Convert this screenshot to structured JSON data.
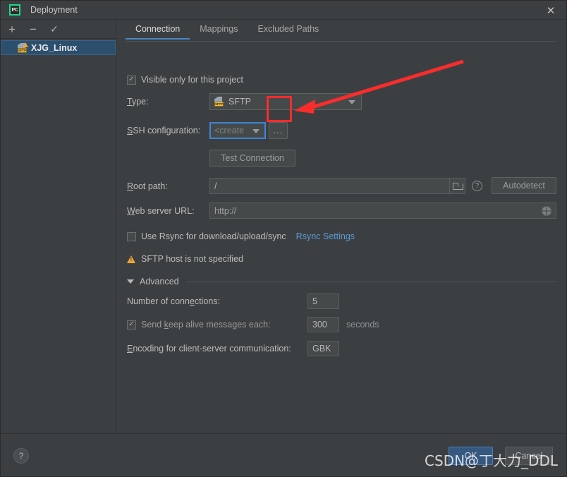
{
  "window": {
    "title": "Deployment",
    "app_icon": "PC",
    "close_label": "✕"
  },
  "sidebar": {
    "toolbar": {
      "add_label": "+",
      "remove_label": "−",
      "default_label": "✓"
    },
    "servers": [
      {
        "name": "XJG_Linux",
        "type_badge": "SFTP",
        "has_warning": true,
        "selected": true
      }
    ]
  },
  "tabs": [
    {
      "label": "Connection",
      "active": true
    },
    {
      "label": "Mappings",
      "active": false
    },
    {
      "label": "Excluded Paths",
      "active": false
    }
  ],
  "connection": {
    "visible_only_label": "Visible only for this project",
    "visible_only_checked": true,
    "type_label": "Type:",
    "type_value": "SFTP",
    "type_badge": "SFTP",
    "ssh_config_label": "SSH configuration:",
    "ssh_config_value": "<create",
    "ssh_config_browse_label": "...",
    "test_connection_label": "Test Connection",
    "root_path_label": "Root path:",
    "root_path_value": "/",
    "autodetect_label": "Autodetect",
    "root_help_label": "?",
    "web_server_url_label": "Web server URL:",
    "web_server_url_value": "http://",
    "use_rsync_label": "Use Rsync for download/upload/sync",
    "use_rsync_checked": false,
    "rsync_settings_link": "Rsync Settings",
    "warning_text": "SFTP host is not specified"
  },
  "advanced": {
    "section_label": "Advanced",
    "expanded": true,
    "connections_label": "Number of connections:",
    "connections_value": "5",
    "keep_alive_label": "Send keep alive messages each:",
    "keep_alive_checked": true,
    "keep_alive_value": "300",
    "keep_alive_unit": "seconds",
    "encoding_label": "Encoding for client-server communication:",
    "encoding_value": "GBK"
  },
  "footer": {
    "help_label": "?",
    "ok_label": "OK",
    "cancel_label": "Cancel"
  },
  "overlay": {
    "watermark_text": "CSDN@丁大力_DDL",
    "annotation_color": "#fb2c2c"
  },
  "colors": {
    "background": "#3c3f41",
    "panel": "#45494a",
    "accent": "#4a88c7",
    "selection": "#2d4f6e",
    "warning": "#f0a732",
    "link": "#5a9bd8",
    "ok_button": "#365880"
  }
}
